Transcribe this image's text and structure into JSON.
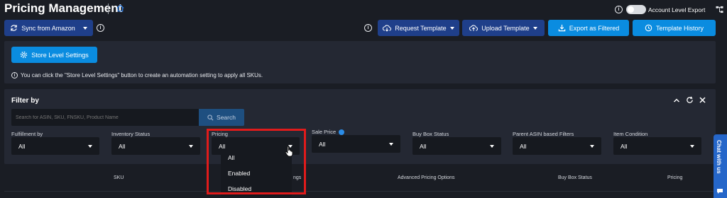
{
  "header": {
    "title": "Pricing Management",
    "account_export_label": "Account Level Export"
  },
  "toolbar": {
    "sync_label": "Sync from Amazon",
    "request_template_label": "Request Template",
    "upload_template_label": "Upload Template",
    "export_filtered_label": "Export as Filtered",
    "template_history_label": "Template History"
  },
  "store": {
    "button_label": "Store Level Settings",
    "info_text": "You can click the \"Store Level Settings\" button to create an automation setting to apply all SKUs."
  },
  "filter": {
    "title": "Filter by",
    "search_placeholder": "Search for ASIN, SKU, FNSKU, Product Name",
    "search_button": "Search",
    "fields": [
      {
        "label": "Fulfillment by",
        "value": "All"
      },
      {
        "label": "Inventory Status",
        "value": "All"
      },
      {
        "label": "Pricing",
        "value": "All"
      },
      {
        "label": "Sale Price",
        "value": "All"
      },
      {
        "label": "Buy Box Status",
        "value": "All"
      },
      {
        "label": "Parent ASIN based Filters",
        "value": "All"
      },
      {
        "label": "Item Condition",
        "value": "All"
      }
    ],
    "pricing_options": [
      "All",
      "Enabled",
      "Disabled"
    ]
  },
  "table": {
    "headers": [
      "SKU",
      "ngs",
      "Advanced Pricing Options",
      "Buy Box Status",
      "Pricing"
    ]
  },
  "chat": {
    "label": "Chat with us"
  },
  "colors": {
    "accent": "#0a8ce0",
    "highlight": "#e01b1b",
    "button_dark": "#1f3f8a"
  }
}
